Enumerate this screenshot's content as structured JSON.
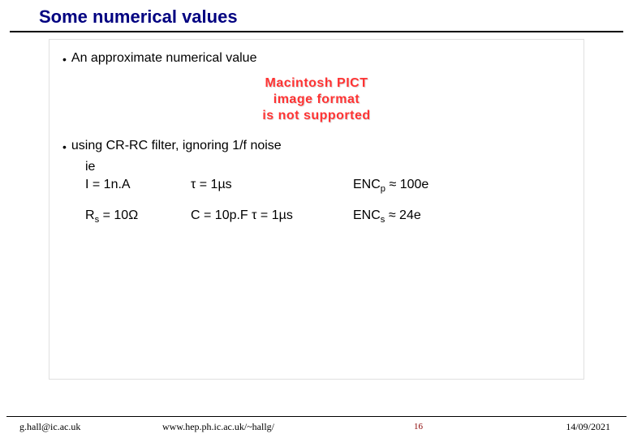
{
  "slide": {
    "title": "Some numerical values",
    "bullet1": "An approximate numerical value",
    "pict_error": "Macintosh PICT\nimage format\nis not supported",
    "bullet2": "using CR-RC filter, ignoring 1/f noise",
    "ie": "ie",
    "line1_col1": "I = 1n.A",
    "line1_col2_tau": "τ = 1µs",
    "line1_col3": "ENCp ≈ 100e",
    "line2_col1": "Rs = 10Ω",
    "line2_col2": "C = 10p.F   τ = 1µs",
    "line2_col3": "ENCs ≈ 24e"
  },
  "footer": {
    "email": "g.hall@ic.ac.uk",
    "url": "www.hep.ph.ic.ac.uk/~hallg/",
    "page": "16",
    "date": "14/09/2021"
  }
}
